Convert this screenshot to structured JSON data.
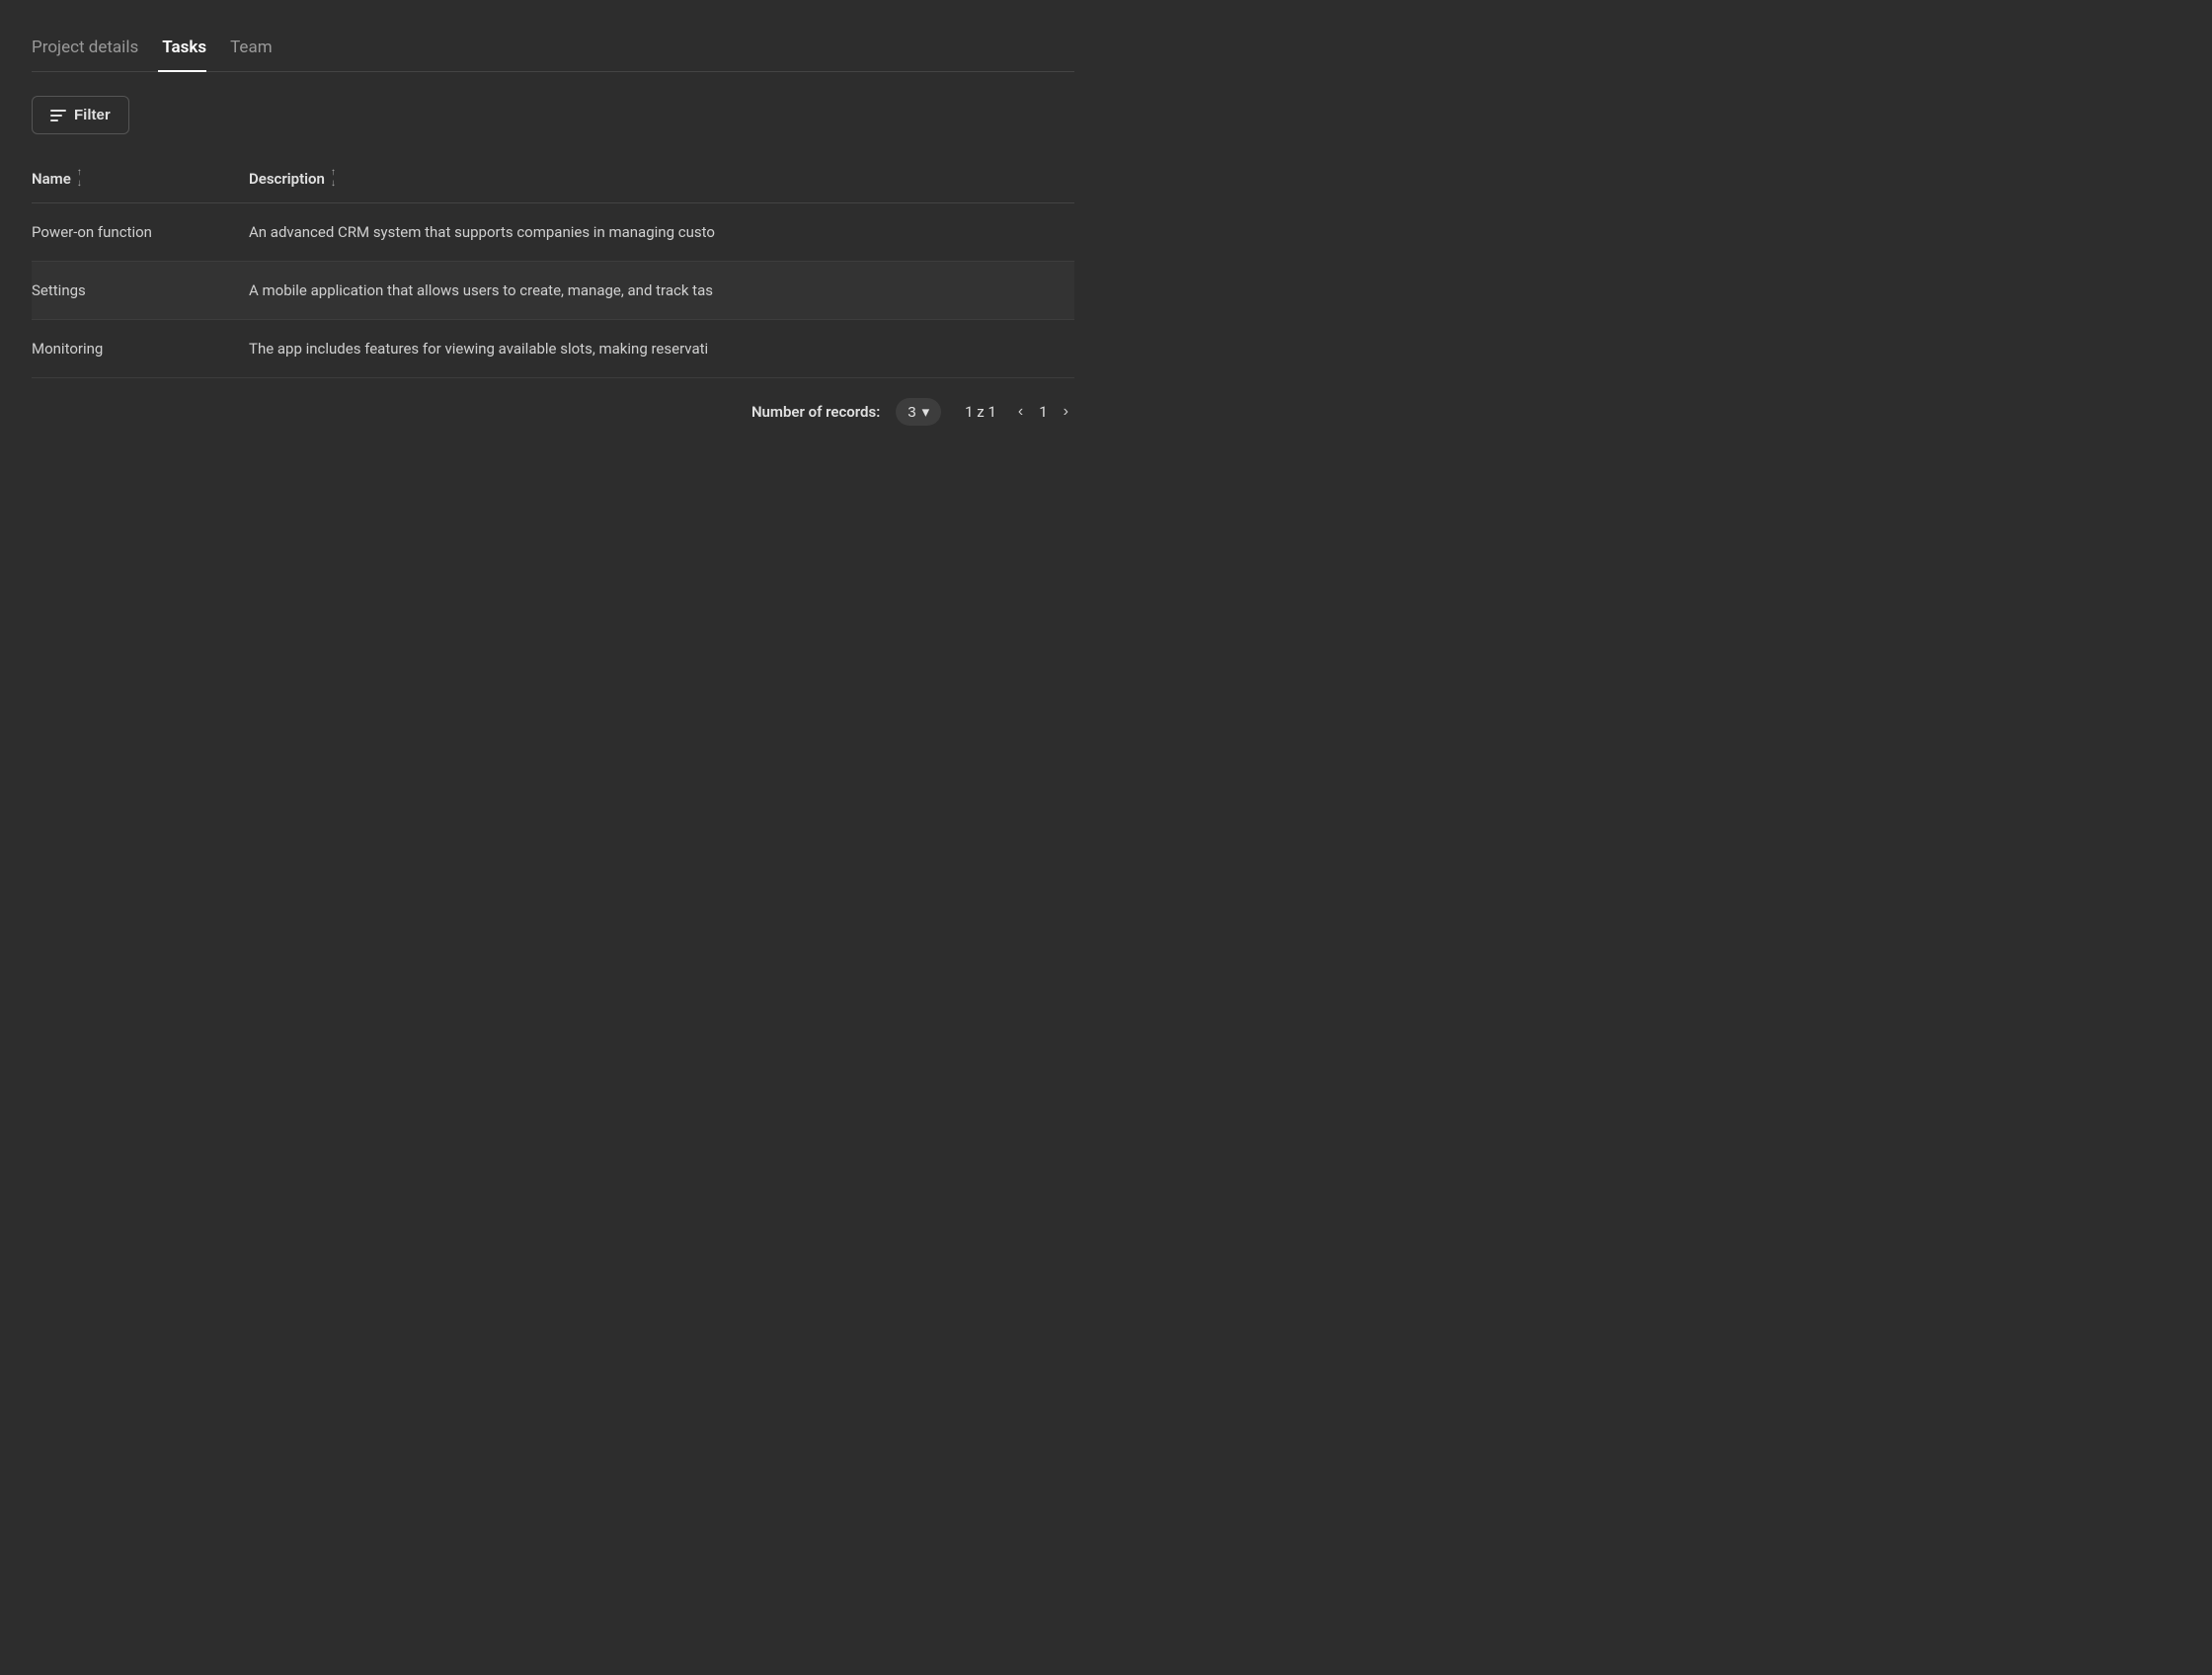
{
  "tabs": [
    {
      "id": "project-details",
      "label": "Project details",
      "active": false
    },
    {
      "id": "tasks",
      "label": "Tasks",
      "active": true
    },
    {
      "id": "team",
      "label": "Team",
      "active": false
    }
  ],
  "filter_button": {
    "label": "Filter"
  },
  "table": {
    "columns": [
      {
        "id": "name",
        "label": "Name",
        "sortable": true
      },
      {
        "id": "description",
        "label": "Description",
        "sortable": true
      }
    ],
    "rows": [
      {
        "name": "Power-on function",
        "description": "An advanced CRM system that supports companies in managing custo",
        "highlighted": false
      },
      {
        "name": "Settings",
        "description": "A mobile application that allows users to create, manage, and track tas",
        "highlighted": true
      },
      {
        "name": "Monitoring",
        "description": "The app includes features for viewing available slots, making reservati",
        "highlighted": false
      }
    ]
  },
  "pagination": {
    "records_label": "Number of records:",
    "records_count": "3",
    "page_info": "1 z 1",
    "current_page": "1"
  },
  "colors": {
    "bg": "#2d2d2d",
    "row_highlight": "#333333",
    "border": "#444444",
    "active_tab_underline": "#ffffff"
  }
}
